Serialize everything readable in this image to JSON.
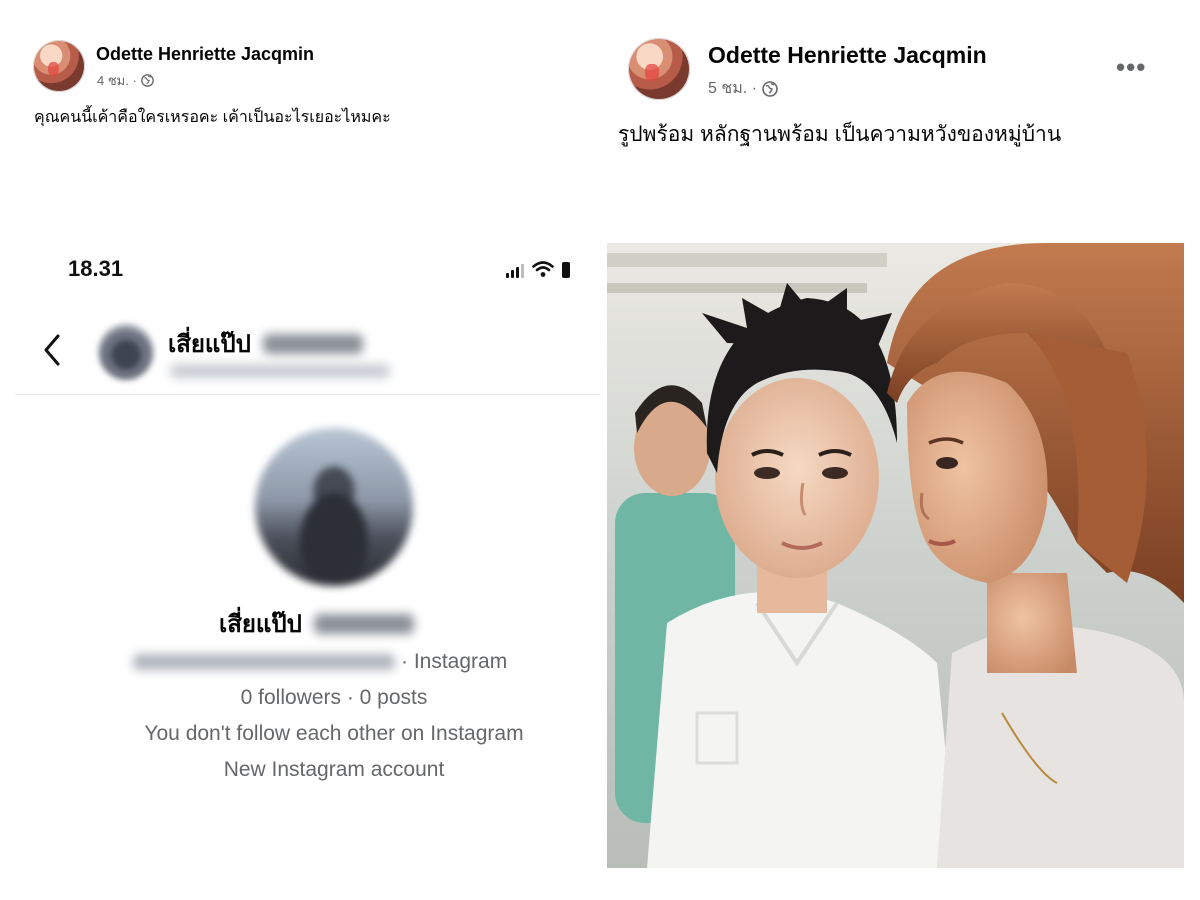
{
  "post_left": {
    "author": "Odette Henriette Jacqmin",
    "time": "4 ชม. ·",
    "text": "คุณคนนี้เค้าคือใครเหรอคะ เค้าเป็นอะไรเยอะไหมคะ"
  },
  "post_right": {
    "author": "Odette Henriette Jacqmin",
    "time": "5 ชม. ·",
    "more": "•••",
    "text": "รูปพร้อม หลักฐานพร้อม เป็นความหวังของหมู่บ้าน"
  },
  "phone_screenshot": {
    "status_time": "18.31",
    "header_name": "เสี่ยแป๊ป",
    "profile_name": "เสี่ยแป๊ป",
    "platform": "· Instagram",
    "counts": "0 followers · 0 posts",
    "follow_status": "You don't follow each other on Instagram",
    "account_note": "New Instagram account"
  },
  "colors": {
    "text_primary": "#050505",
    "text_secondary": "#65676b",
    "divider": "#e4e6eb"
  }
}
